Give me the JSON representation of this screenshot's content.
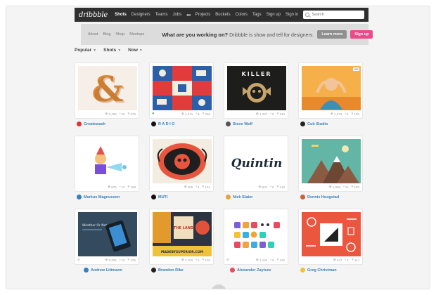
{
  "nav": {
    "logo": "dribbble",
    "links": [
      "Shots",
      "Designers",
      "Teams",
      "Jobs",
      "Projects",
      "Buckets",
      "Colors",
      "Tags"
    ],
    "dots": "•••",
    "signup": "Sign up",
    "signin": "Sign in",
    "search_placeholder": "Search"
  },
  "banner": {
    "links": [
      "About",
      "Blog",
      "Shop",
      "Meetups"
    ],
    "question": "What are you working on?",
    "tagline": "Dribbble is show and tell for designers.",
    "learn_more": "Learn more",
    "signup": "Sign up"
  },
  "filters": [
    "Popular",
    "Shots",
    "Now"
  ],
  "shots": [
    {
      "views": "3,493",
      "comments": "23",
      "likes": "379",
      "author": "Createwash"
    },
    {
      "views": "1,271",
      "comments": "9",
      "likes": "256",
      "author": "R A D I O"
    },
    {
      "views": "1,267",
      "comments": "5",
      "likes": "240",
      "author": "Steve Wolf"
    },
    {
      "views": "1,670",
      "comments": "5",
      "likes": "180",
      "author": "Cub Studio"
    },
    {
      "views": "875",
      "comments": "12",
      "likes": "168",
      "author": "Markus Magnusson"
    },
    {
      "views": "486",
      "comments": "4",
      "likes": "151",
      "author": "MUTI"
    },
    {
      "views": "601",
      "comments": "6",
      "likes": "148",
      "author": "Nick Slater"
    },
    {
      "views": "1,800",
      "comments": "11",
      "likes": "180",
      "author": "Dennis Hoogstad"
    },
    {
      "views": "5,305",
      "comments": "10",
      "likes": "106",
      "author": "Andrew Littmann"
    },
    {
      "views": "2,700",
      "comments": "5",
      "likes": "130",
      "author": "Brandon Rike"
    },
    {
      "views": "1,105",
      "comments": "6",
      "likes": "122",
      "author": "Alexander Zaytsev"
    },
    {
      "views": "547",
      "comments": "1",
      "likes": "114",
      "author": "Greg Christman"
    }
  ],
  "art": {
    "killer_title": "KILLER",
    "quintin_word": "Quintin",
    "land_word": "THE LAND",
    "land_sub": "MADEBYSUPERIOR.COM",
    "gif": "GIF",
    "weather": "Weather Or Not"
  },
  "colors": {
    "accent_pink": "#ea4c89",
    "link_blue": "#3a7fb8",
    "nav_dark": "#2f2f2f"
  },
  "icons": {
    "views": "eye-icon",
    "comments": "comment-icon",
    "likes": "heart-icon",
    "attachment": "paperclip-icon"
  }
}
